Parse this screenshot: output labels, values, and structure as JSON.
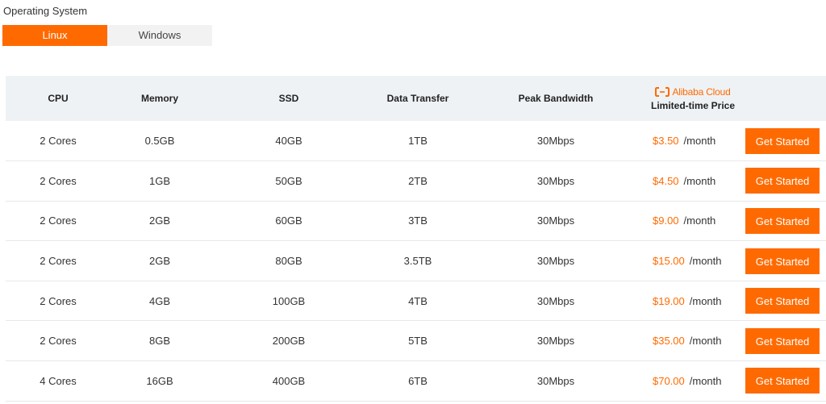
{
  "os": {
    "label": "Operating System",
    "tabs": [
      {
        "label": "Linux",
        "active": true
      },
      {
        "label": "Windows",
        "active": false
      }
    ]
  },
  "table": {
    "headers": {
      "cpu": "CPU",
      "memory": "Memory",
      "ssd": "SSD",
      "transfer": "Data Transfer",
      "bandwidth": "Peak Bandwidth",
      "brand": "Alibaba Cloud",
      "price": "Limited-time Price"
    },
    "rows": [
      {
        "cpu": "2 Cores",
        "memory": "0.5GB",
        "ssd": "40GB",
        "transfer": "1TB",
        "bandwidth": "30Mbps",
        "price": "$3.50",
        "per": "/month",
        "action": "Get Started"
      },
      {
        "cpu": "2 Cores",
        "memory": "1GB",
        "ssd": "50GB",
        "transfer": "2TB",
        "bandwidth": "30Mbps",
        "price": "$4.50",
        "per": "/month",
        "action": "Get Started"
      },
      {
        "cpu": "2 Cores",
        "memory": "2GB",
        "ssd": "60GB",
        "transfer": "3TB",
        "bandwidth": "30Mbps",
        "price": "$9.00",
        "per": "/month",
        "action": "Get Started"
      },
      {
        "cpu": "2 Cores",
        "memory": "2GB",
        "ssd": "80GB",
        "transfer": "3.5TB",
        "bandwidth": "30Mbps",
        "price": "$15.00",
        "per": "/month",
        "action": "Get Started"
      },
      {
        "cpu": "2 Cores",
        "memory": "4GB",
        "ssd": "100GB",
        "transfer": "4TB",
        "bandwidth": "30Mbps",
        "price": "$19.00",
        "per": "/month",
        "action": "Get Started"
      },
      {
        "cpu": "2 Cores",
        "memory": "8GB",
        "ssd": "200GB",
        "transfer": "5TB",
        "bandwidth": "30Mbps",
        "price": "$35.00",
        "per": "/month",
        "action": "Get Started"
      },
      {
        "cpu": "4 Cores",
        "memory": "16GB",
        "ssd": "400GB",
        "transfer": "6TB",
        "bandwidth": "30Mbps",
        "price": "$70.00",
        "per": "/month",
        "action": "Get Started"
      }
    ]
  },
  "colors": {
    "accent": "#ff6a00",
    "header_bg": "#eef2f5"
  },
  "icons": {
    "brand_logo": "alibaba-cloud-logo-icon"
  }
}
